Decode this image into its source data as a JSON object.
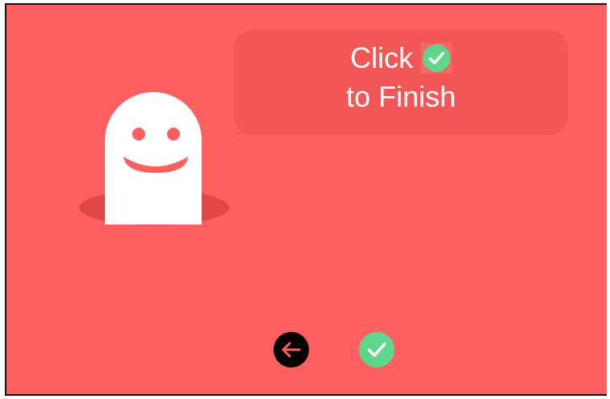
{
  "colors": {
    "background": "#fe5f5f",
    "bubble": "#f25757",
    "ghost_body": "#ffffff",
    "ghost_features": "#fe5f5f",
    "hole": "#e04848",
    "check_green": "#5ed68b",
    "inline_check_highlight": "#f46868",
    "back_button_fill": "#000000",
    "back_arrow": "#fe5f5f"
  },
  "bubble": {
    "line1": "Click",
    "line2": "to Finish",
    "inline_icon": "check-circle-icon"
  },
  "controls": {
    "back_icon": "arrow-left-icon",
    "finish_icon": "check-circle-icon"
  }
}
